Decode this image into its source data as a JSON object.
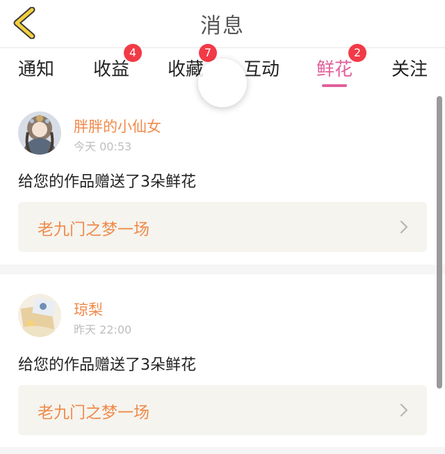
{
  "header": {
    "title": "消息",
    "back_icon": "chevron-left-icon",
    "back_color": "#f4d03f"
  },
  "tabs": [
    {
      "label": "通知"
    },
    {
      "label": "收益",
      "badge": "4"
    },
    {
      "label": "收藏",
      "badge": "7"
    },
    {
      "label": "互动"
    },
    {
      "label": "鲜花",
      "badge": "2",
      "active": true
    },
    {
      "label": "关注"
    }
  ],
  "colors": {
    "accent": "#e0609a",
    "name": "#f08a4b",
    "badge": "#f23a47"
  },
  "messages": [
    {
      "username": "胖胖的小仙女",
      "time": "今天 00:53",
      "text": "给您的作品赠送了3朵鲜花",
      "work_title": "老九门之梦一场"
    },
    {
      "username": "琼梨",
      "time": "昨天 22:00",
      "text": "给您的作品赠送了3朵鲜花",
      "work_title": "老九门之梦一场"
    }
  ]
}
